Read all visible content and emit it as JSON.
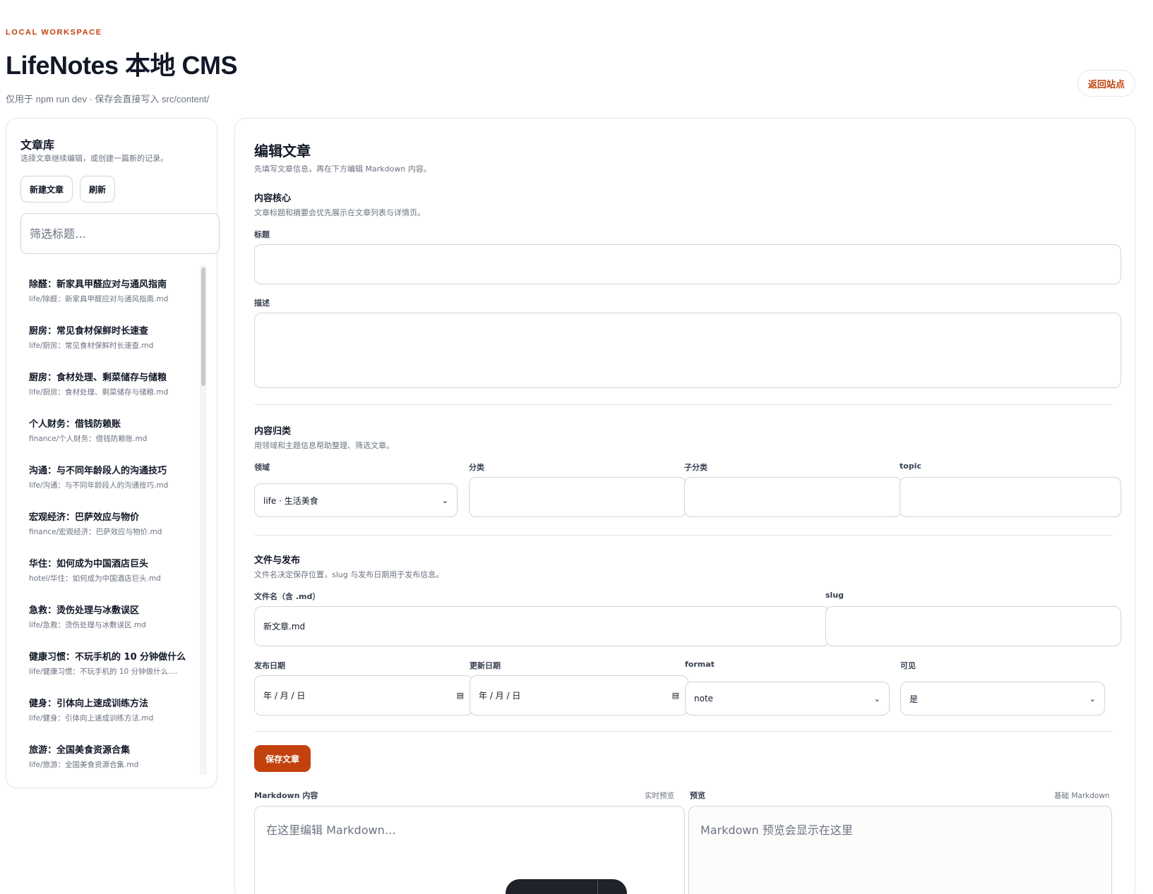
{
  "header": {
    "eyebrow": "LOCAL WORKSPACE",
    "title": "LifeNotes 本地 CMS",
    "subtitle": "仅用于 npm run dev · 保存会直接写入 src/content/",
    "back_label": "返回站点"
  },
  "library": {
    "title": "文章库",
    "desc": "选择文章继续编辑，或创建一篇新的记录。",
    "new_label": "新建文章",
    "refresh_label": "刷新",
    "filter_placeholder": "筛选标题…",
    "items": [
      {
        "title": "除醛：新家具甲醛应对与通风指南",
        "path": "life/除醛：新家具甲醛应对与通风指南.md"
      },
      {
        "title": "厨房：常见食材保鲜时长速查",
        "path": "life/厨房：常见食材保鲜时长速查.md"
      },
      {
        "title": "厨房：食材处理、剩菜储存与储粮",
        "path": "life/厨房：食材处理、剩菜储存与储粮.md"
      },
      {
        "title": "个人财务：借钱防赖账",
        "path": "finance/个人财务：借钱防赖账.md"
      },
      {
        "title": "沟通：与不同年龄段人的沟通技巧",
        "path": "life/沟通：与不同年龄段人的沟通技巧.md"
      },
      {
        "title": "宏观经济：巴萨效应与物价",
        "path": "finance/宏观经济：巴萨效应与物价.md"
      },
      {
        "title": "华住：如何成为中国酒店巨头",
        "path": "hotel/华住：如何成为中国酒店巨头.md"
      },
      {
        "title": "急救：烫伤处理与冰敷误区",
        "path": "life/急救：烫伤处理与冰敷误区.md"
      },
      {
        "title": "健康习惯：不玩手机的 10 分钟做什么",
        "path": "life/健康习惯：不玩手机的 10 分钟做什么...."
      },
      {
        "title": "健身：引体向上速成训练方法",
        "path": "life/健身：引体向上速成训练方法.md"
      },
      {
        "title": "旅游：全国美食资源合集",
        "path": "life/旅游：全国美食资源合集.md"
      }
    ]
  },
  "editor": {
    "title": "编辑文章",
    "desc": "先填写文章信息，再在下方编辑 Markdown 内容。",
    "core": {
      "title": "内容核心",
      "desc": "文章标题和摘要会优先展示在文章列表与详情页。",
      "title_label": "标题",
      "title_value": "",
      "desc_label": "描述",
      "desc_value": ""
    },
    "category": {
      "title": "内容归类",
      "desc": "用领域和主题信息帮助整理、筛选文章。",
      "domain_label": "领域",
      "domain_value": "life · 生活美食",
      "cat_label": "分类",
      "subcat_label": "子分类",
      "topic_label": "topic"
    },
    "publish": {
      "title": "文件与发布",
      "desc": "文件名决定保存位置，slug 与发布日期用于发布信息。",
      "filename_label": "文件名（含 .md）",
      "filename_value": "新文章.md",
      "slug_label": "slug",
      "pubdate_label": "发布日期",
      "pubdate_value": "年 / 月 / 日",
      "update_label": "更新日期",
      "update_value": "年 / 月 / 日",
      "format_label": "format",
      "format_value": "note",
      "visible_label": "可见",
      "visible_value": "是"
    },
    "save_label": "保存文章",
    "markdown": {
      "label": "Markdown 内容",
      "note": "实时预览",
      "placeholder": "在这里编辑 Markdown…"
    },
    "preview": {
      "label": "预览",
      "note": "基础 Markdown",
      "placeholder": "Markdown 预览会显示在这里"
    }
  },
  "colors": {
    "accent": "#c2410c",
    "border": "#e5e7eb"
  }
}
